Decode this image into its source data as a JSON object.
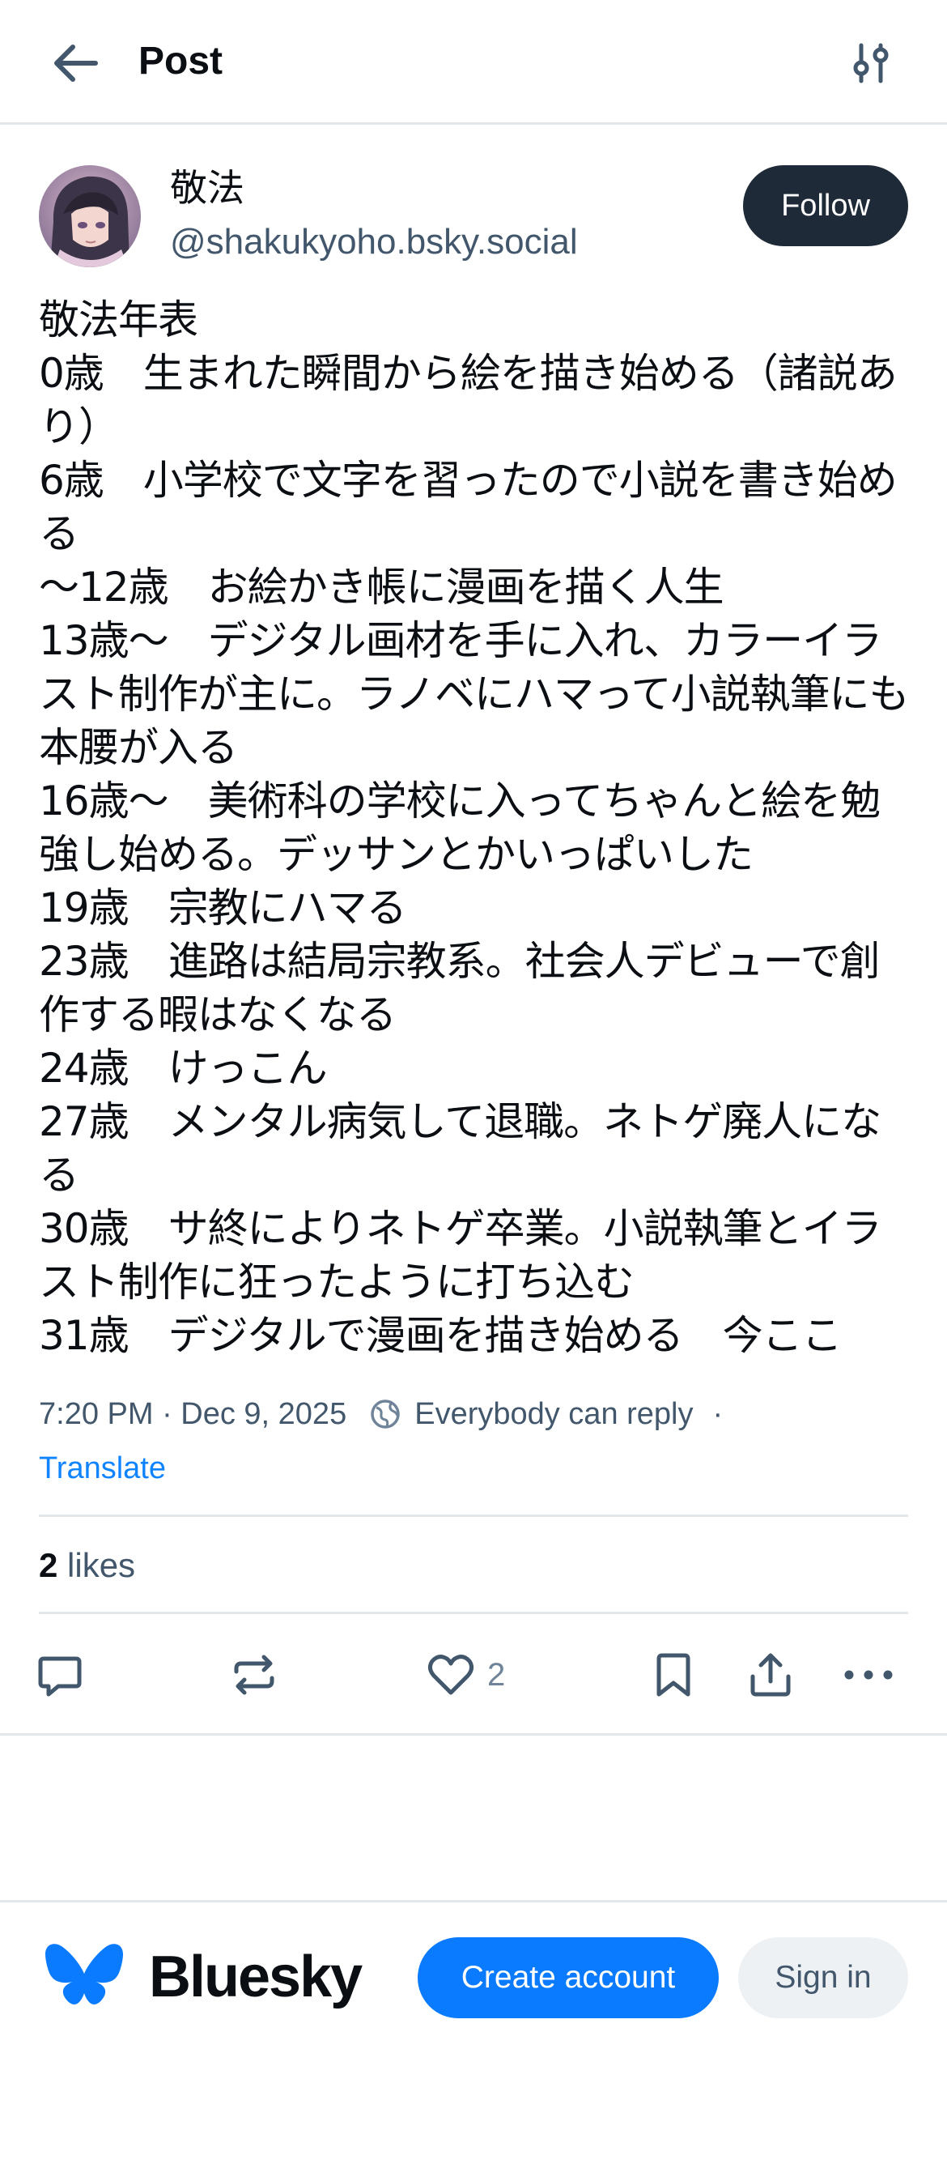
{
  "header": {
    "title": "Post",
    "back_icon": "arrow-left-icon",
    "filter_icon": "sliders-icon"
  },
  "post": {
    "author": {
      "display_name": "敬法",
      "handle": "@shakukyoho.bsky.social",
      "avatar_icon": "avatar-anime-portrait"
    },
    "follow_label": "Follow",
    "text": "敬法年表\n0歳　生まれた瞬間から絵を描き始める（諸説あり）\n6歳　小学校で文字を習ったので小説を書き始める\n〜12歳　お絵かき帳に漫画を描く人生\n13歳〜　デジタル画材を手に入れ、カラーイラスト制作が主に。ラノベにハマって小説執筆にも本腰が入る\n16歳〜　美術科の学校に入ってちゃんと絵を勉強し始める。デッサンとかいっぱいした\n19歳　宗教にハマる\n23歳　進路は結局宗教系。社会人デビューで創作する暇はなくなる\n24歳　けっこん\n27歳　メンタル病気して退職。ネトゲ廃人になる\n30歳　サ終によりネトゲ卒業。小説執筆とイラスト制作に狂ったように打ち込む\n31歳　デジタルで漫画を描き始める　今ここ",
    "timestamp": "7:20 PM · Dec 9, 2025",
    "reply_setting": "Everybody can reply",
    "separator": "·",
    "translate_label": "Translate",
    "likes": {
      "count": "2",
      "label": "likes"
    },
    "actions": {
      "like_count": "2"
    }
  },
  "bottom_bar": {
    "brand_name": "Bluesky",
    "create_account_label": "Create account",
    "sign_in_label": "Sign in"
  },
  "colors": {
    "accent": "#0a7aff",
    "link": "#1083fe",
    "follow_bg": "#1f2a38",
    "muted_text": "#42576c",
    "divider": "#e3e7eb"
  }
}
